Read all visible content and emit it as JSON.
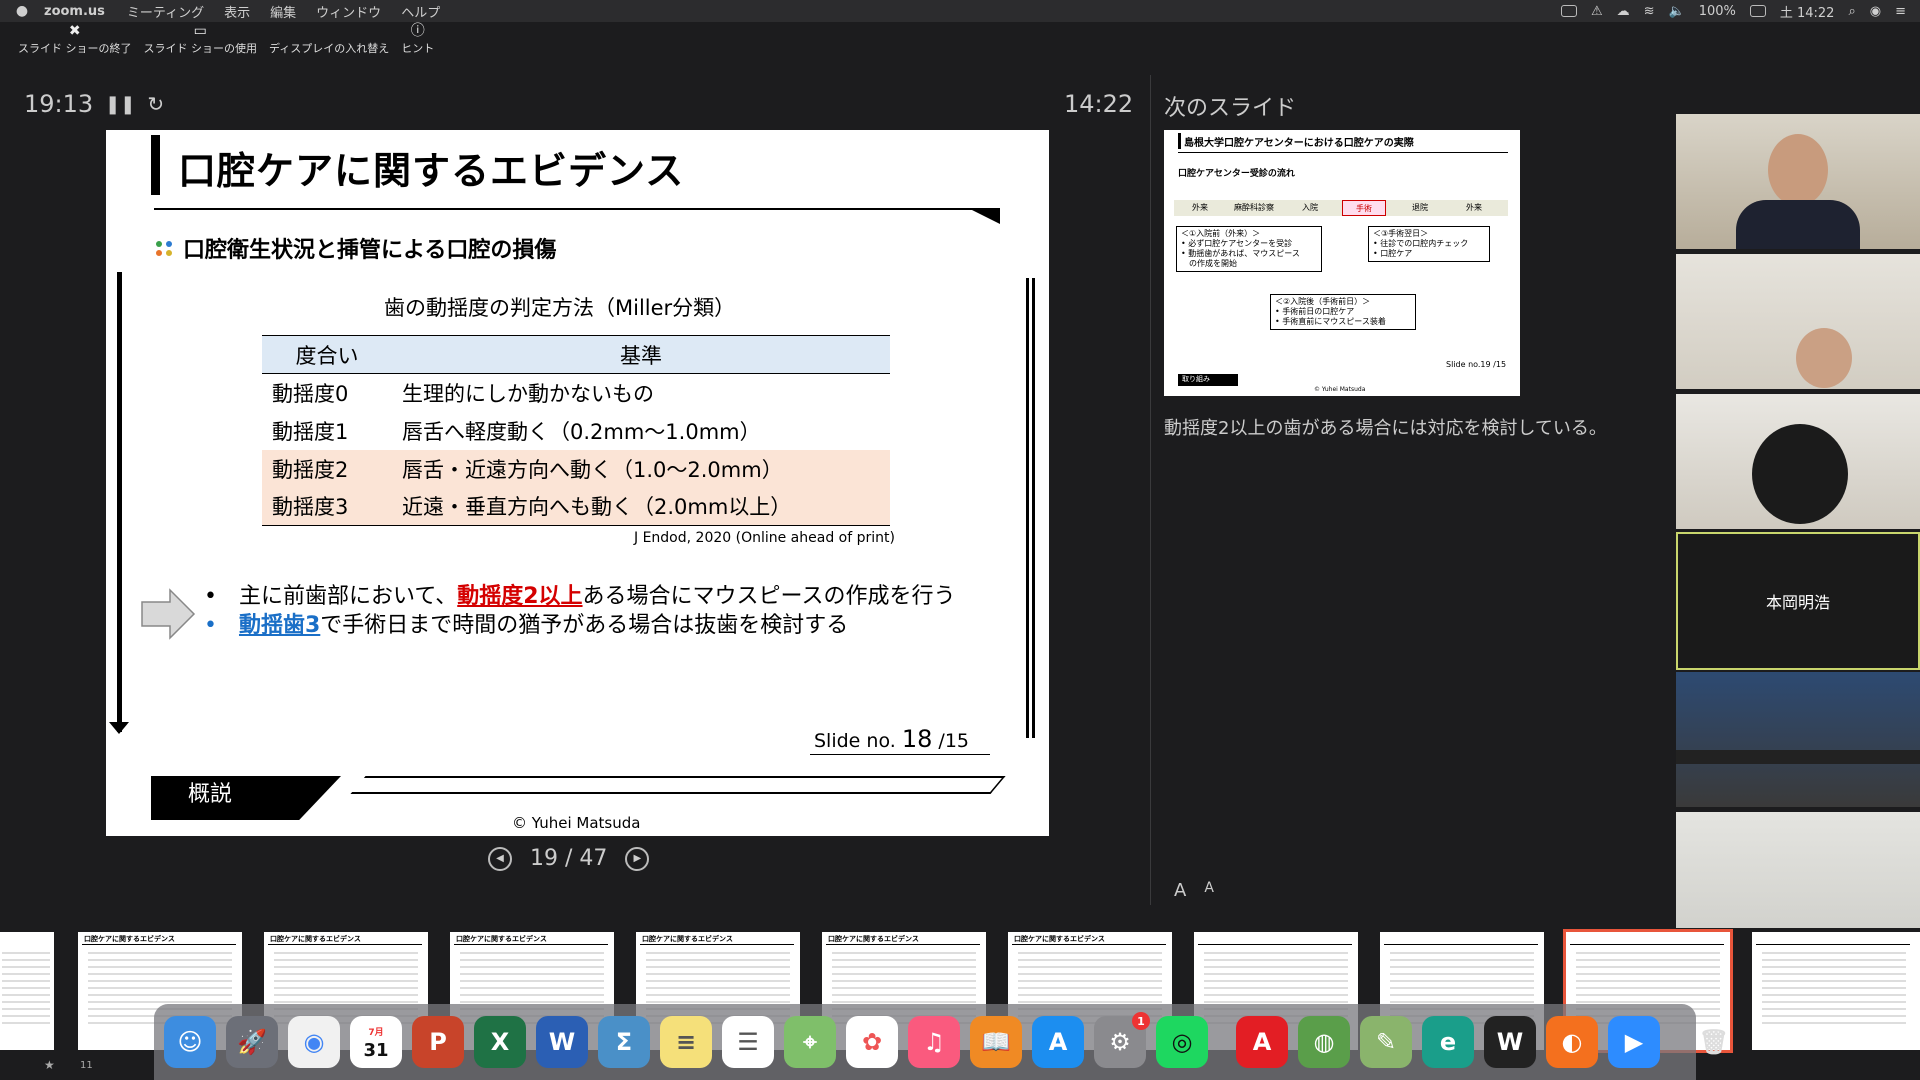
{
  "menubar": {
    "app_name": "zoom.us",
    "items": [
      "ミーティング",
      "表示",
      "編集",
      "ウィンドウ",
      "ヘルプ"
    ],
    "battery": "100%",
    "clock": "土 14:22"
  },
  "toolbar": {
    "end": "スライド ショーの終了",
    "use": "スライド ショーの使用",
    "swap": "ディスプレイの入れ替え",
    "hint": "ヒント"
  },
  "presenter": {
    "elapsed": "19:13",
    "clock": "14:22",
    "page": "19 / 47",
    "next_label": "次のスライド",
    "note": "動揺度2以上の歯がある場合には対応を検討している。"
  },
  "slide": {
    "title": "口腔ケアに関するエビデンス",
    "subtitle": "口腔衛生状況と挿管による口腔の損傷",
    "table_title": "歯の動揺度の判定方法（Miller分類）",
    "table_headers": [
      "度合い",
      "基準"
    ],
    "rows": [
      {
        "grade": "動揺度0",
        "desc": "生理的にしか動かないもの"
      },
      {
        "grade": "動揺度1",
        "desc": "唇舌へ軽度動く（0.2mm～1.0mm）"
      },
      {
        "grade": "動揺度2",
        "desc": "唇舌・近遠方向へ動く（1.0～2.0mm）"
      },
      {
        "grade": "動揺度3",
        "desc": "近遠・垂直方向へも動く（2.0mm以上）"
      }
    ],
    "citation": "J Endod, 2020 (Online ahead of print)",
    "bullet1_pre": "主に前歯部において、",
    "bullet1_hl": "動揺度2以上",
    "bullet1_post": "ある場合にマウスピースの作成を行う",
    "bullet2_hl": "動揺歯3",
    "bullet2_post": "で手術日まで時間の猶予がある場合は抜歯を検討する",
    "slide_no_pre": "Slide no.",
    "slide_no": "18",
    "slide_total": "/15",
    "footer_label": "概説",
    "copyright": "© Yuhei Matsuda"
  },
  "next_slide": {
    "title": "島根大学口腔ケアセンターにおける口腔ケアの実際",
    "subtitle": "口腔ケアセンター受診の流れ",
    "steps": [
      "外来",
      "麻酔科診察",
      "入院",
      "手術",
      "退院",
      "外来"
    ],
    "box1": "＜①入院前（外来）＞\n• 必ず口腔ケアセンターを受診\n• 動揺歯があれば、マウスピース\n　の作成を開始",
    "box2": "＜③手術翌日＞\n• 往診での口腔内チェック\n• 口腔ケア",
    "box3": "＜②入院後（手術前日）＞\n• 手術前日の口腔ケア\n• 手術直前にマウスピース装着",
    "footer": "取り組み",
    "slide_no": "Slide no.19 /15",
    "copyright": "© Yuhei Matsuda"
  },
  "participants": {
    "named_tile": "本岡明浩"
  },
  "font_buttons": [
    "A",
    "A"
  ],
  "filmstrip": {
    "thumb_titles": [
      "口腔ケアに関するエビデンス",
      "口腔ケアに関するエビデンス",
      "口腔ケアに関するエビデンス",
      "口腔ケアに関するエビデンス",
      "口腔ケアに関するエビデンス",
      "口腔ケアに関するエビデンス"
    ],
    "first_num": "11"
  },
  "dock": {
    "calendar_month": "7月",
    "calendar_day": "31",
    "badge": "1"
  }
}
